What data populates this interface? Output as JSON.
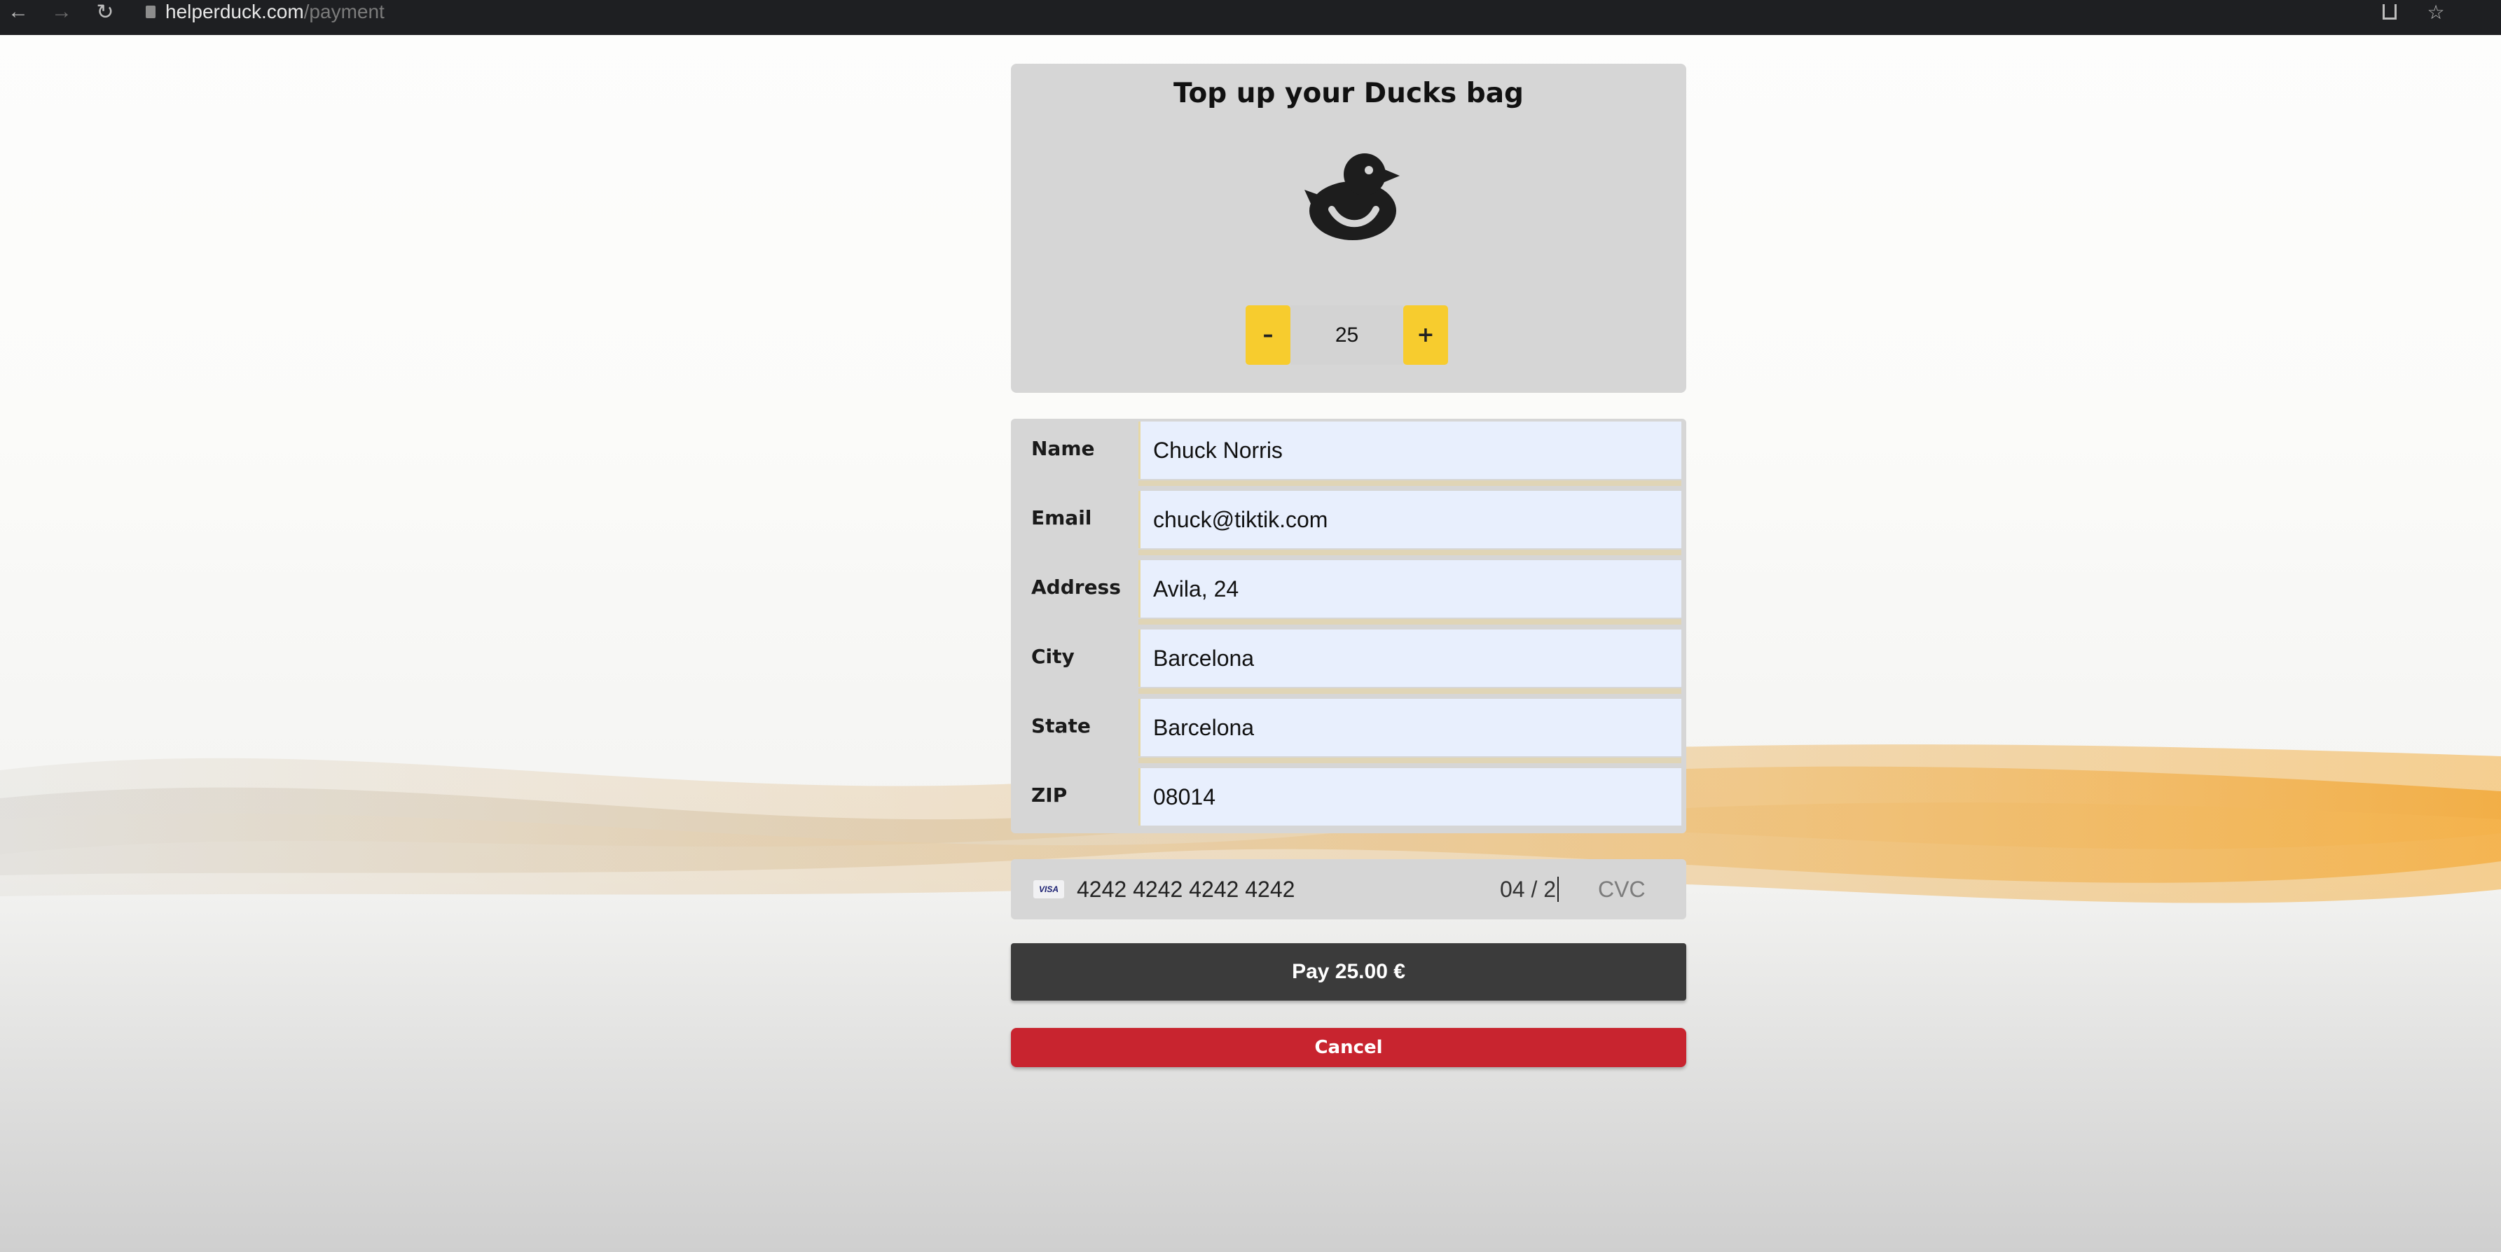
{
  "browser": {
    "url_host": "helperduck.com",
    "url_path": "/payment",
    "back_glyph": "←",
    "forward_glyph": "→",
    "reload_glyph": "↻",
    "star_glyph": "☆"
  },
  "card": {
    "title": "Top up your Ducks bag",
    "icon": "duck-icon",
    "quantity": "25",
    "minus_label": "–",
    "plus_label": "+"
  },
  "form": {
    "fields": [
      {
        "label": "Name",
        "value": "Chuck Norris"
      },
      {
        "label": "Email",
        "value": "chuck@tiktik.com"
      },
      {
        "label": "Address",
        "value": "Avila, 24"
      },
      {
        "label": "City",
        "value": "Barcelona"
      },
      {
        "label": "State",
        "value": "Barcelona"
      },
      {
        "label": "ZIP",
        "value": "08014"
      }
    ]
  },
  "payment": {
    "card_brand": "VISA",
    "card_number": "4242 4242 4242 4242",
    "expiry": "04 / 2",
    "cvc_placeholder": "CVC"
  },
  "actions": {
    "pay_label": "Pay 25.00 €",
    "cancel_label": "Cancel"
  },
  "colors": {
    "accent_yellow": "#f7cc2e",
    "pay_button": "#3b3b3b",
    "cancel_button": "#c8242f",
    "input_fill": "#e8effd",
    "panel": "#d6d6d6"
  }
}
